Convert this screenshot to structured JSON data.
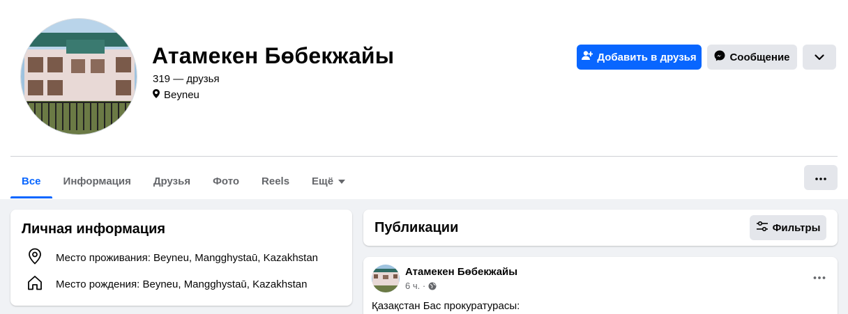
{
  "profile": {
    "name": "Атамекен Бөбекжайы",
    "friends": "319 — друзья",
    "location": "Beyneu"
  },
  "actions": {
    "add_friend": "Добавить в друзья",
    "message": "Сообщение"
  },
  "tabs": [
    {
      "label": "Все",
      "active": true
    },
    {
      "label": "Информация"
    },
    {
      "label": "Друзья"
    },
    {
      "label": "Фото"
    },
    {
      "label": "Reels"
    },
    {
      "label": "Ещё"
    }
  ],
  "intro": {
    "title": "Личная информация",
    "lives_in": "Место проживания: Beyneu, Mangghystaū, Kazakhstan",
    "born_in": "Место рождения: Beyneu, Mangghystaū, Kazakhstan"
  },
  "posts": {
    "title": "Публикации",
    "filters": "Фильтры",
    "first_post": {
      "author": "Атамекен Бөбекжайы",
      "time": "6 ч. ·",
      "text": "Қазақстан Бас прокуратурасы:"
    }
  },
  "colors": {
    "accent": "#0866ff",
    "background": "#f0f2f5",
    "button_gray": "#e4e6eb",
    "secondary_text": "#65676b"
  },
  "icons": [
    "user-plus-icon",
    "messenger-icon",
    "chevron-down-icon",
    "location-pin-icon",
    "home-icon",
    "more-horizontal-icon",
    "filter-icon",
    "globe-icon"
  ]
}
